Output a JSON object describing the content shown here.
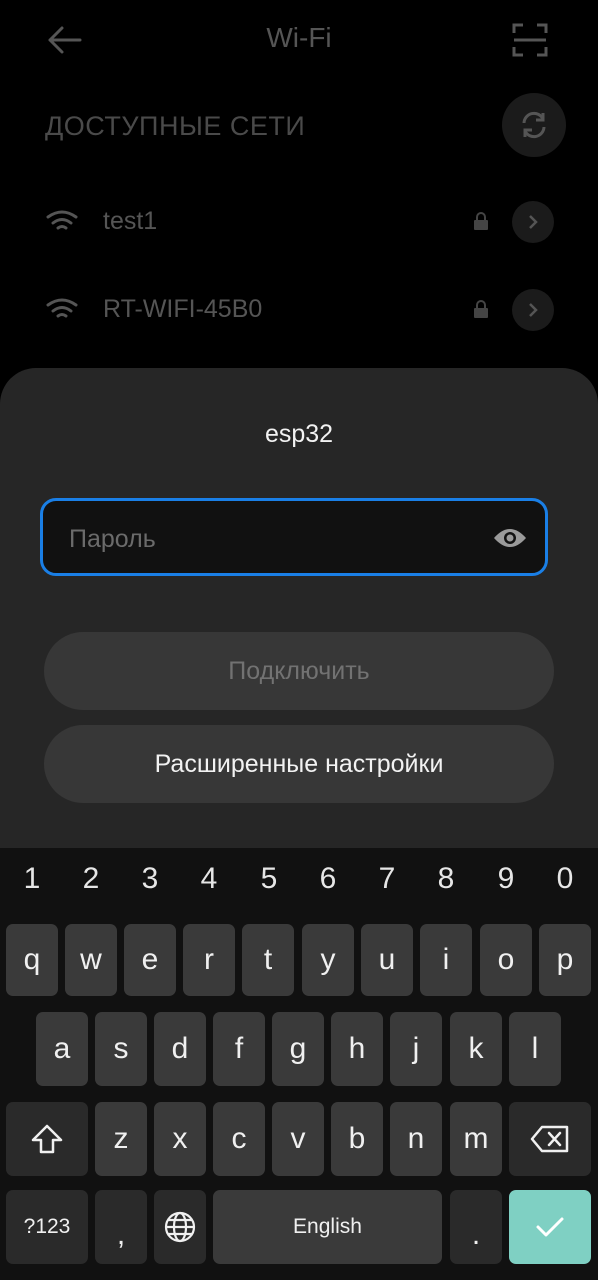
{
  "header": {
    "title": "Wi-Fi"
  },
  "networks_section": {
    "label": "ДОСТУПНЫЕ СЕТИ",
    "items": [
      {
        "name": "test1"
      },
      {
        "name": "RT-WIFI-45B0"
      }
    ]
  },
  "sheet": {
    "network_name": "esp32",
    "password_placeholder": "Пароль",
    "connect_label": "Подключить",
    "advanced_label": "Расширенные настройки"
  },
  "keyboard": {
    "numbers": [
      "1",
      "2",
      "3",
      "4",
      "5",
      "6",
      "7",
      "8",
      "9",
      "0"
    ],
    "row1": [
      "q",
      "w",
      "e",
      "r",
      "t",
      "y",
      "u",
      "i",
      "o",
      "p"
    ],
    "row2": [
      "a",
      "s",
      "d",
      "f",
      "g",
      "h",
      "j",
      "k",
      "l"
    ],
    "row3": [
      "z",
      "x",
      "c",
      "v",
      "b",
      "n",
      "m"
    ],
    "symbols_label": "?123",
    "comma": ",",
    "space_label": "English",
    "period": "."
  },
  "colors": {
    "accent": "#1a7fe6",
    "enter_key": "#7fd0c3"
  }
}
